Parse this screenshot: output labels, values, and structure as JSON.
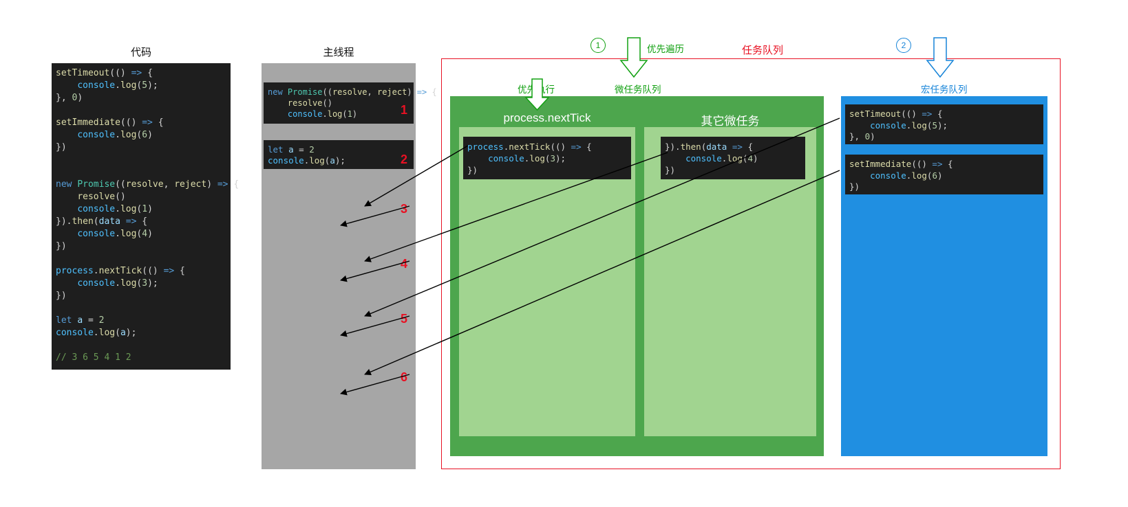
{
  "titles": {
    "code": "代码",
    "main_thread": "主线程"
  },
  "labels": {
    "priority_execute": "优先执行",
    "priority_traverse": "优先遍历",
    "micro_queue": "微任务队列",
    "task_queue": "任务队列",
    "macro_queue": "宏任务队列"
  },
  "circle_nums": {
    "one": "1",
    "two": "2"
  },
  "micro_cols": {
    "nexttick_title": "process.nextTick",
    "other_title": "其它微任务"
  },
  "code_main": "setTimeout(() => {\n    console.log(5);\n}, 0)\n\nsetImmediate(() => {\n    console.log(6)\n})\n\n\nnew Promise((resolve, reject) => {\n    resolve()\n    console.log(1)\n}).then(data => {\n    console.log(4)\n})\n\nprocess.nextTick(() => {\n    console.log(3);\n})\n\nlet a = 2\nconsole.log(a);\n\n// 3 6 5 4 1 2",
  "snippets": {
    "promise": "new Promise((resolve, reject) => {\n    resolve()\n    console.log(1)",
    "let_a": "let a = 2\nconsole.log(a);",
    "nexttick": "process.nextTick(() => {\n    console.log(3);\n})",
    "then": "}).then(data => {\n    console.log(4)\n})",
    "settimeout": "setTimeout(() => {\n    console.log(5);\n}, 0)",
    "setimmediate": "setImmediate(() => {\n    console.log(6)\n})"
  },
  "main_nums": {
    "n1": "1",
    "n2": "2",
    "n3": "3",
    "n4": "4",
    "n5": "5",
    "n6": "6"
  },
  "arrows": {
    "main_thread_targets": [
      [
        595,
        300,
        495,
        328
      ],
      [
        595,
        380,
        495,
        408
      ],
      [
        595,
        460,
        495,
        488
      ],
      [
        595,
        545,
        495,
        573
      ]
    ],
    "flow": [
      [
        680,
        212,
        530,
        300
      ],
      [
        970,
        222,
        530,
        380
      ],
      [
        1220,
        172,
        530,
        460
      ],
      [
        1220,
        248,
        530,
        545
      ]
    ]
  }
}
